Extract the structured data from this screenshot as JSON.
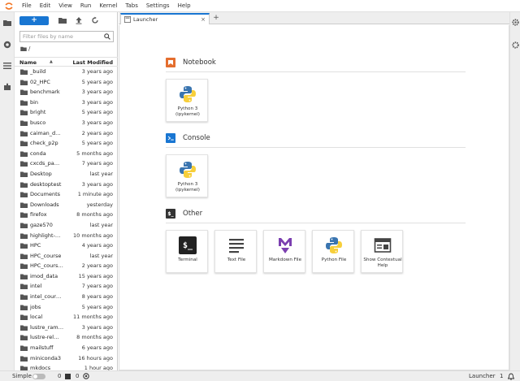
{
  "menubar": {
    "items": [
      "File",
      "Edit",
      "View",
      "Run",
      "Kernel",
      "Tabs",
      "Settings",
      "Help"
    ]
  },
  "filebrowser": {
    "new_label": "+",
    "search_placeholder": "Filter files by name",
    "breadcrumb": "/",
    "header": {
      "name": "Name",
      "sort_glyph": "▲",
      "modified": "Last Modified"
    },
    "files": [
      {
        "name": "_build",
        "modified": "3 years ago"
      },
      {
        "name": "02_HPC",
        "modified": "5 years ago"
      },
      {
        "name": "benchmark",
        "modified": "3 years ago"
      },
      {
        "name": "bin",
        "modified": "3 years ago"
      },
      {
        "name": "bright",
        "modified": "5 years ago"
      },
      {
        "name": "busco",
        "modified": "3 years ago"
      },
      {
        "name": "caiman_d…",
        "modified": "2 years ago"
      },
      {
        "name": "check_p2p",
        "modified": "5 years ago"
      },
      {
        "name": "conda",
        "modified": "5 months ago"
      },
      {
        "name": "cxcds_pa…",
        "modified": "7 years ago"
      },
      {
        "name": "Desktop",
        "modified": "last year"
      },
      {
        "name": "desktoptest",
        "modified": "3 years ago"
      },
      {
        "name": "Documents",
        "modified": "1 minute ago"
      },
      {
        "name": "Downloads",
        "modified": "yesterday"
      },
      {
        "name": "firefox",
        "modified": "8 months ago"
      },
      {
        "name": "gaze570",
        "modified": "last year"
      },
      {
        "name": "highlight-…",
        "modified": "10 months ago"
      },
      {
        "name": "HPC",
        "modified": "4 years ago"
      },
      {
        "name": "HPC_course",
        "modified": "last year"
      },
      {
        "name": "HPC_cours…",
        "modified": "2 years ago"
      },
      {
        "name": "imod_data",
        "modified": "15 years ago"
      },
      {
        "name": "intel",
        "modified": "7 years ago"
      },
      {
        "name": "intel_cour…",
        "modified": "8 years ago"
      },
      {
        "name": "jobs",
        "modified": "5 years ago"
      },
      {
        "name": "local",
        "modified": "11 months ago"
      },
      {
        "name": "lustre_ram…",
        "modified": "3 years ago"
      },
      {
        "name": "lustre-rel…",
        "modified": "8 months ago"
      },
      {
        "name": "mailstuff",
        "modified": "6 years ago"
      },
      {
        "name": "miniconda3",
        "modified": "16 hours ago"
      },
      {
        "name": "mkdocs",
        "modified": "1 hour ago"
      }
    ]
  },
  "tabs": [
    {
      "label": "Launcher",
      "close": "×"
    }
  ],
  "tab_add": "+",
  "launcher": {
    "sections": [
      {
        "title": "Notebook",
        "icon": "notebook-icon",
        "color": "#e46e2e",
        "cards": [
          {
            "label": "Python 3 (ipykernel)",
            "icon": "python-logo"
          }
        ]
      },
      {
        "title": "Console",
        "icon": "console-icon",
        "color": "#1976d2",
        "cards": [
          {
            "label": "Python 3 (ipykernel)",
            "icon": "python-logo"
          }
        ]
      },
      {
        "title": "Other",
        "icon": "terminal-icon",
        "color": "#333333",
        "cards": [
          {
            "label": "Terminal",
            "icon": "terminal-icon"
          },
          {
            "label": "Text File",
            "icon": "text-file-icon"
          },
          {
            "label": "Markdown File",
            "icon": "markdown-icon"
          },
          {
            "label": "Python File",
            "icon": "python-logo"
          },
          {
            "label": "Show Contextual Help",
            "icon": "contextual-help-icon"
          }
        ]
      }
    ]
  },
  "statusbar": {
    "mode": "Simple",
    "count_a": "0",
    "count_b": "0",
    "right_label": "Launcher",
    "right_count": "1"
  },
  "colors": {
    "accent": "#1976d2",
    "markdown": "#7b3fb0",
    "python_blue": "#3a75b0",
    "python_yellow": "#f7cf3b"
  }
}
